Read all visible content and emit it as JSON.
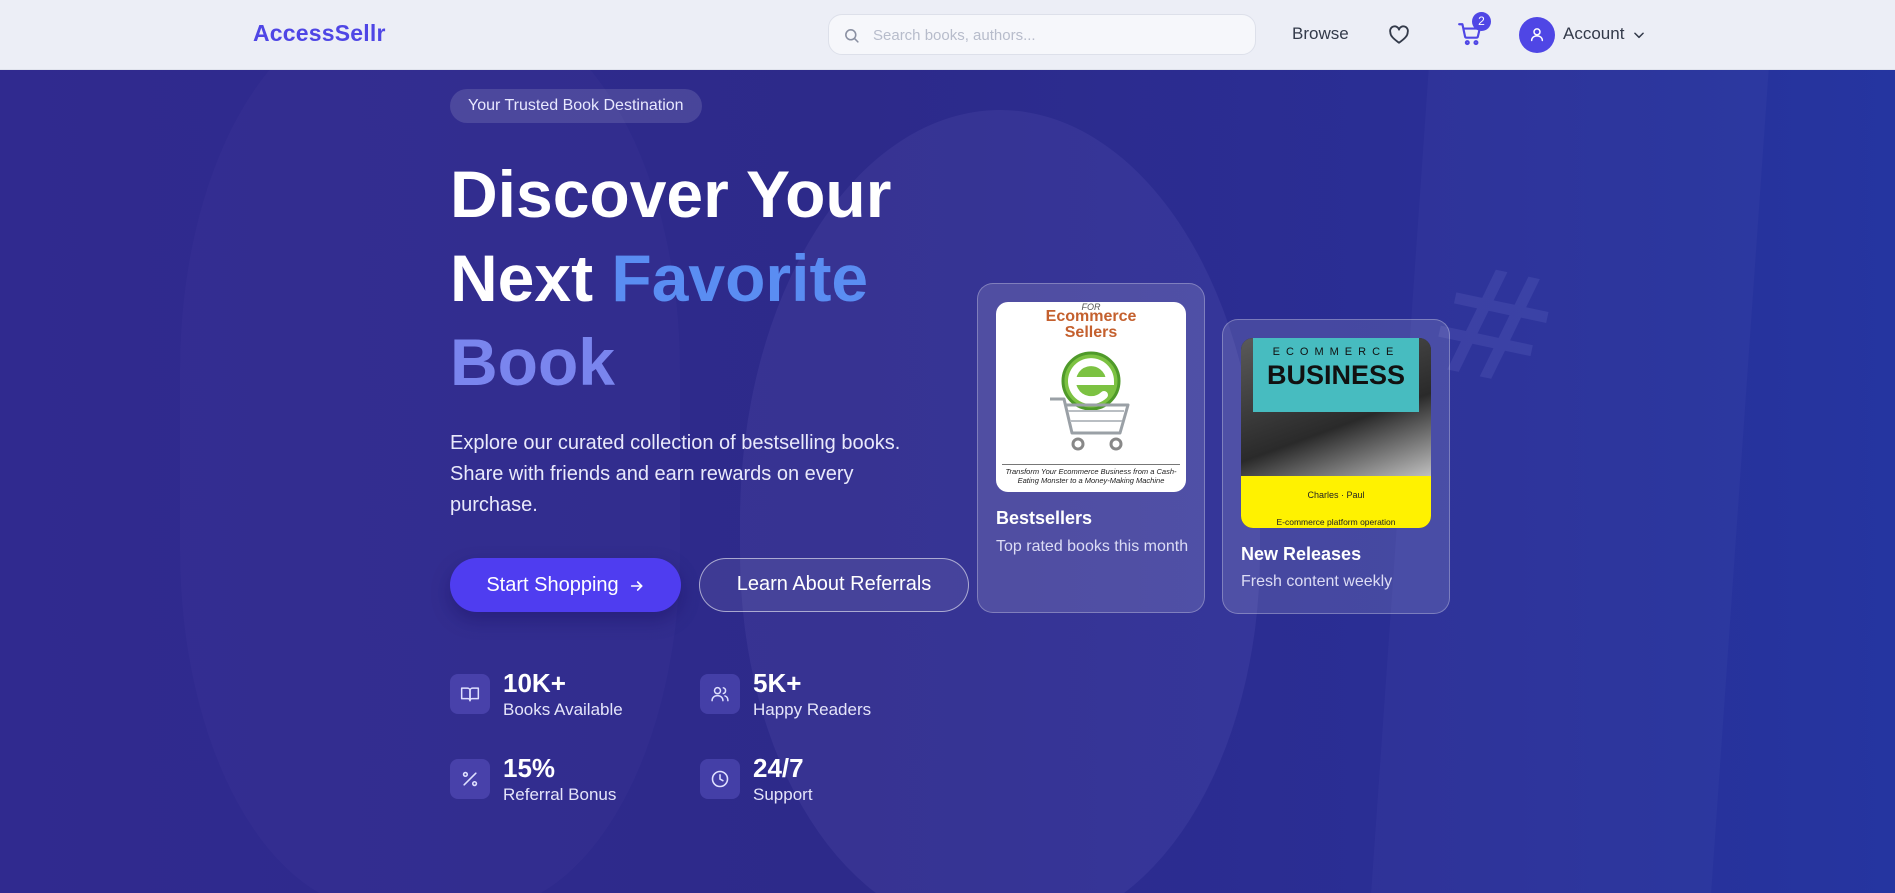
{
  "header": {
    "logo": "AccessSellr",
    "search_placeholder": "Search books, authors...",
    "browse_label": "Browse",
    "cart_count": "2",
    "account_label": "Account",
    "icons": [
      "search-icon",
      "heart-icon",
      "cart-icon",
      "user-icon",
      "chevron-down-icon"
    ]
  },
  "hero": {
    "badge": "Your Trusted Book Destination",
    "title_line1": "Discover Your",
    "title_line2_plain": "Next ",
    "title_line2_accent": "Favorite",
    "title_line3_accent": "Book",
    "lead": "Explore our curated collection of bestselling books. Share with friends and earn rewards on every purchase.",
    "primary_button": "Start Shopping",
    "secondary_button": "Learn About Referrals",
    "stats": [
      {
        "value": "10K+",
        "label": "Books Available",
        "icon": "book-icon"
      },
      {
        "value": "5K+",
        "label": "Happy Readers",
        "icon": "users-icon"
      },
      {
        "value": "15%",
        "label": "Referral Bonus",
        "icon": "percent-icon"
      },
      {
        "value": "24/7",
        "label": "Support",
        "icon": "clock-icon"
      }
    ]
  },
  "cards": [
    {
      "title": "Bestsellers",
      "subtitle": "Top rated books this month",
      "cover": {
        "top": "FOR",
        "title_1": "Ecommerce",
        "title_2": "Sellers",
        "subtitle": "Transform Your Ecommerce Business from a Cash-Eating Monster to a Money-Making Machine"
      }
    },
    {
      "title": "New Releases",
      "subtitle": "Fresh content weekly",
      "cover": {
        "top": "ECOMMERCE",
        "title": "BUSINESS",
        "author": "Charles · Paul",
        "bottom": "E-commerce platform operation"
      }
    }
  ],
  "colors": {
    "brand": "#4f46e5",
    "accent_blue": "#5a8df2",
    "accent_indigo": "#7a85ee",
    "hero_bg": "#2c2a86"
  }
}
